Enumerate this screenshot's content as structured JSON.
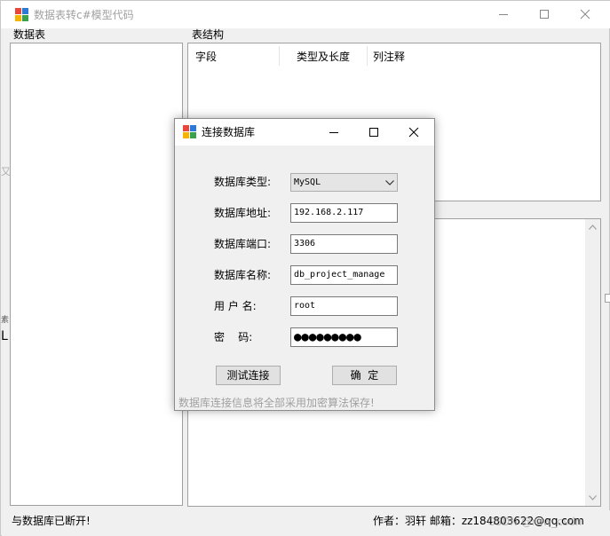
{
  "main": {
    "title": "数据表转c#模型代码",
    "left_group_label": "数据表",
    "right_group_label": "表结构",
    "columns": [
      "字段",
      "类型及长度",
      "列注释"
    ],
    "left_edge_glyphs": [
      "又",
      "素",
      "L"
    ],
    "status_left": "与数据库已断开!",
    "status_right": "作者：羽轩  邮箱：zz184803622@qq.com"
  },
  "dialog": {
    "title": "连接数据库",
    "labels": {
      "db_type": "数据库类型:",
      "db_host": "数据库地址:",
      "db_port": "数据库端口:",
      "db_name": "数据库名称:",
      "username": "用 户 名:",
      "password": "密    码:"
    },
    "values": {
      "db_type": "MySQL",
      "db_host": "192.168.2.117",
      "db_port": "3306",
      "db_name": "db_project_manage",
      "username": "root",
      "password_mask": "●●●●●●●●●"
    },
    "buttons": {
      "test": "测试连接",
      "ok": "确  定"
    },
    "hint": "数据库连接信息将全部采用加密算法保存!"
  },
  "watermark": "CSDN @raw_csdn",
  "icons": [
    "app-icon",
    "minimize-icon",
    "maximize-icon",
    "close-icon",
    "chevron-down-icon",
    "scroll-up-arrow-icon",
    "scroll-down-arrow-icon"
  ],
  "colors": {
    "icon_red": "#e8473b",
    "icon_blue": "#2b79d8",
    "icon_yellow": "#f4b400",
    "icon_green": "#3aa24a",
    "disabled_text": "#a0a0a0"
  }
}
